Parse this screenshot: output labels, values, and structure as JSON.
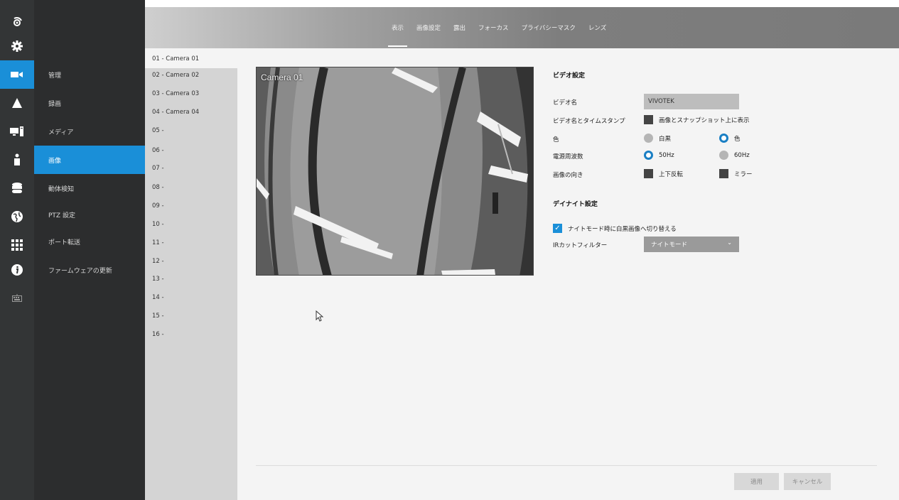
{
  "tabs": [
    "表示",
    "画像設定",
    "露出",
    "フォーカス",
    "プライバシーマスク",
    "レンズ"
  ],
  "menu": [
    "管理",
    "録画",
    "メディア",
    "画像",
    "動体検知",
    "PTZ 設定",
    "ポート転送",
    "ファームウェアの更新"
  ],
  "cameras": [
    "01 - Camera 01",
    "02 - Camera 02",
    "03 - Camera 03",
    "04 - Camera 04",
    "05 -",
    "06 -",
    "07 -",
    "08 -",
    "09 -",
    "10 -",
    "11 -",
    "12 -",
    "13 -",
    "14 -",
    "15 -",
    "16 -"
  ],
  "preview": {
    "label": "Camera 01"
  },
  "video_settings": {
    "title": "ビデオ設定",
    "name_label": "ビデオ名",
    "name_value": "VIVOTEK",
    "stamp_label": "ビデオ名とタイムスタンプ",
    "stamp_option": "画像とスナップショット上に表示",
    "color_label": "色",
    "color_bw": "白黒",
    "color_color": "色",
    "freq_label": "電源周波数",
    "freq_50": "50Hz",
    "freq_60": "60Hz",
    "orient_label": "画像の向き",
    "orient_flip": "上下反転",
    "orient_mirror": "ミラー"
  },
  "daynight": {
    "title": "デイナイト設定",
    "switch_bw": "ナイトモード時に白黒画像へ切り替える",
    "ir_label": "IRカットフィルター",
    "ir_value": "ナイトモード"
  },
  "buttons": {
    "apply": "適用",
    "cancel": "キャンセル"
  },
  "colors": {
    "accent": "#1a8fd8",
    "rail": "#333536",
    "menu": "#2c2d2e"
  }
}
